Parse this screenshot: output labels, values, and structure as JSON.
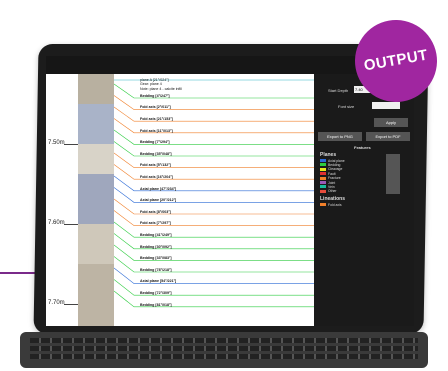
{
  "badge": {
    "label": "OUTPUT"
  },
  "depth_labels": [
    "7.50m",
    "7.60m",
    "7.70m"
  ],
  "top_annotation": {
    "line1": "plane A [21°/024°]",
    "line2": "Gear: plane 4",
    "line3": "Note: plane 4 - calcite infill"
  },
  "features": [
    "Bedding [4°/247°]",
    "Fold axis [2°/011°]",
    "Fold axis [21°/153°]",
    "Fold axis [11°/013°]",
    "Bedding [7°/294°]",
    "Bedding [35°/048°]",
    "Fold axis [5°/132°]",
    "Fold axis [16°/204°]",
    "Axial plane [47°/234°]",
    "Axial plane [20°/212°]",
    "Fold axis [8°/003°]",
    "Fold axis [7°/297°]",
    "Bedding [41°/249°]",
    "Bedding [30°/092°]",
    "Bedding [33°/083°]",
    "Bedding [78°/218°]",
    "Axial plane [54°/221°]",
    "Bedding [72°/309°]",
    "Bedding [81°/018°]"
  ],
  "feature_colors": [
    "#2ecc40",
    "#f07f2a",
    "#f07f2a",
    "#f07f2a",
    "#2ecc40",
    "#2ecc40",
    "#f07f2a",
    "#f07f2a",
    "#2d6bd6",
    "#2d6bd6",
    "#f07f2a",
    "#f07f2a",
    "#2ecc40",
    "#2ecc40",
    "#2ecc40",
    "#2ecc40",
    "#2d6bd6",
    "#2ecc40",
    "#2ecc40"
  ],
  "sidebar": {
    "start_depth_label": "Start Depth",
    "start_depth_value": "7.40",
    "font_size_label": "Font size",
    "apply_label": "Apply",
    "export_png": "Export to PNG",
    "export_pdf": "Export to PDF",
    "features_heading": "Features",
    "planes_heading": "Planes",
    "lineations_heading": "Lineations",
    "plane_items": [
      "Axial plane",
      "Bedding",
      "Cleavage",
      "Fault",
      "Fracture",
      "Joint",
      "Vein",
      "Other"
    ],
    "plane_colors": [
      "#2d6bd6",
      "#2ecc40",
      "#e8e820",
      "#e03030",
      "#f07f2a",
      "#9b59b6",
      "#1abc9c",
      "#e74c3c"
    ],
    "lineation_items": [
      "Fold axis"
    ],
    "lineation_colors": [
      "#f07f2a"
    ]
  }
}
